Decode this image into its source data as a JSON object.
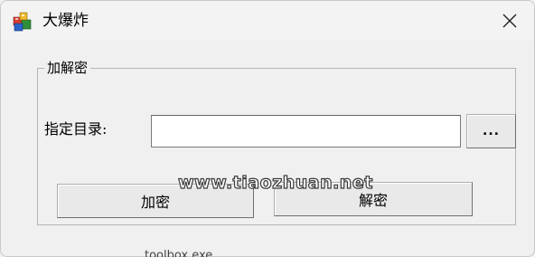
{
  "window": {
    "title": "大爆炸",
    "icon": "app-cube-icon",
    "close_icon": "close-icon"
  },
  "group": {
    "legend": "加解密"
  },
  "directory": {
    "label": "指定目录:",
    "value": "",
    "browse_label": "..."
  },
  "actions": {
    "encrypt_label": "加密",
    "decrypt_label": "解密"
  },
  "overlay": {
    "watermark": "www.tiaozhuan.net"
  },
  "background": {
    "partial_text": "toolbox.exe"
  },
  "colors": {
    "window_bg": "#f0f0f0",
    "titlebar_bg": "#f3f3f3",
    "input_bg": "#ffffff",
    "button_bg": "#e9e9e9"
  }
}
